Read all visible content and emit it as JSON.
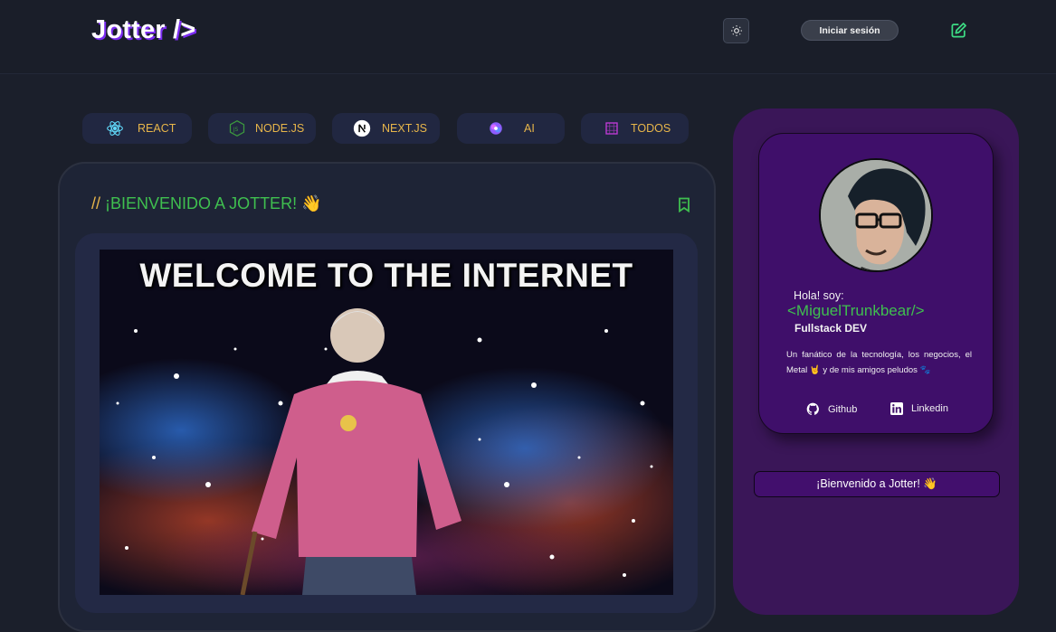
{
  "header": {
    "logo": "Jotter />",
    "login_label": "Iniciar sesión",
    "icons": [
      "sun-icon",
      "edit-note-icon"
    ]
  },
  "categories": [
    {
      "label": "REACT",
      "icon": "react-icon",
      "color": "#61dafb"
    },
    {
      "label": "NODE.JS",
      "icon": "nodejs-icon",
      "color": "#3c873a"
    },
    {
      "label": "NEXT.JS",
      "icon": "nextjs-icon",
      "color": "#ffffff"
    },
    {
      "label": "AI",
      "icon": "ai-icon",
      "color": "#b37cff"
    },
    {
      "label": "TODOS",
      "icon": "grid-icon",
      "color": "#c03ad6"
    }
  ],
  "post": {
    "prefix": "//",
    "title": "¡BIENVENIDO A JOTTER! 👋",
    "image_caption": "WELCOME TO THE INTERNET",
    "bookmark_icon": "bookmark-icon"
  },
  "profile": {
    "greeting": "Hola! soy:",
    "name": "<MiguelTrunkbear/>",
    "role": "Fullstack DEV",
    "bio": "Un fanático de la tecnología, los negocios, el Metal 🤘 y de mis amigos peludos 🐾",
    "links": [
      {
        "label": "Github",
        "icon": "github-icon"
      },
      {
        "label": "Linkedin",
        "icon": "linkedin-icon"
      }
    ]
  },
  "sidebar": {
    "welcome_label": "¡Bienvenido a Jotter! 👋"
  },
  "colors": {
    "accent_green": "#3fbf4f",
    "accent_yellow": "#e8b64a",
    "purple": "#3f0f6a",
    "background": "#1b1f2b"
  }
}
